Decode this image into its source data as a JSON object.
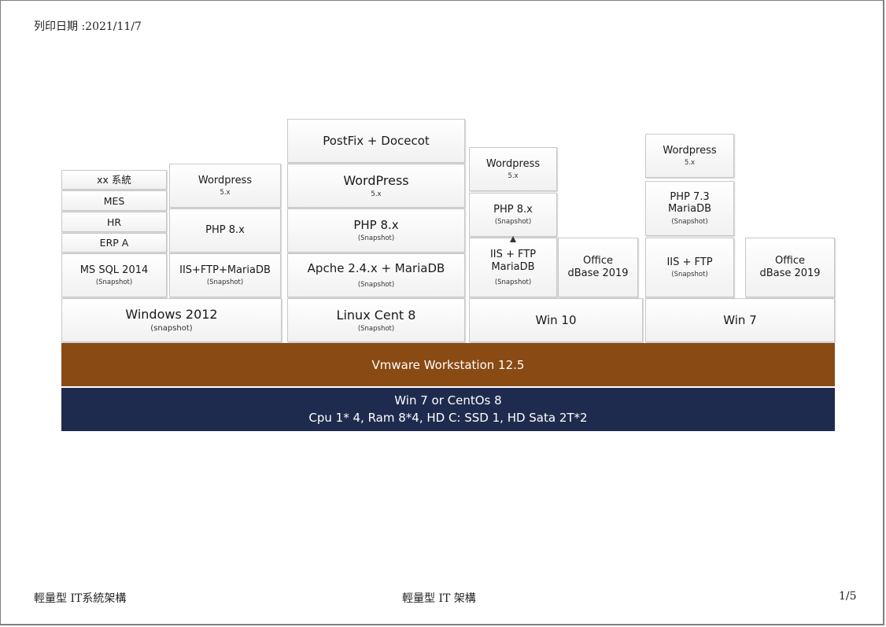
{
  "header": {
    "print_date": "列印日期 :2021/11/7"
  },
  "footer": {
    "left": "輕量型 IT系統架構",
    "center": "輕量型 IT 架構",
    "right": "1/5"
  },
  "diagram": {
    "host": {
      "line1": "Win 7 or CentOs 8",
      "line2": "Cpu 1* 4,  Ram 8*4, HD C: SSD 1, HD Sata 2T*2"
    },
    "hypervisor": {
      "label": "Vmware Workstation 12.5"
    },
    "win2012": {
      "os": "Windows 2012",
      "os_note": "(snapshot)",
      "mssql": "MS SQL 2014",
      "mssql_note": "(Snapshot)",
      "erp": "ERP A",
      "hr": "HR",
      "mes": "MES",
      "xx": "xx 系統",
      "iis": "IIS+FTP+MariaDB",
      "iis_note": "(Snapshot)",
      "php": "PHP 8.x",
      "wordpress": "Wordpress",
      "wordpress_ver": "5.x"
    },
    "linux": {
      "os": "Linux Cent 8",
      "os_note": "(Snapshot)",
      "apache": "Apche 2.4.x + MariaDB",
      "apache_note": "(Snapshot)",
      "php": "PHP 8.x",
      "php_note": "(Snapshot)",
      "wordpress": "WordPress",
      "wordpress_ver": "5.x",
      "postfix": "PostFix + Docecot"
    },
    "win10": {
      "os": "Win 10",
      "iis_line1": "IIS + FTP",
      "iis_line2": "MariaDB",
      "iis_note": "(Snapshot)",
      "office_line1": "Office",
      "office_line2": "dBase 2019",
      "php": "PHP 8.x",
      "php_note": "(Snapshot)",
      "wordpress": "Wordpress",
      "wordpress_ver": "5.x"
    },
    "win7": {
      "os": "Win 7",
      "iis": "IIS + FTP",
      "iis_note": "(Snapshot)",
      "office_line1": "Office",
      "office_line2": "dBase 2019",
      "php_line1": "PHP 7.3",
      "php_line2": "MariaDB",
      "php_note": "(Snapshot)",
      "wordpress": "Wordpress",
      "wordpress_ver": "5.x"
    }
  }
}
